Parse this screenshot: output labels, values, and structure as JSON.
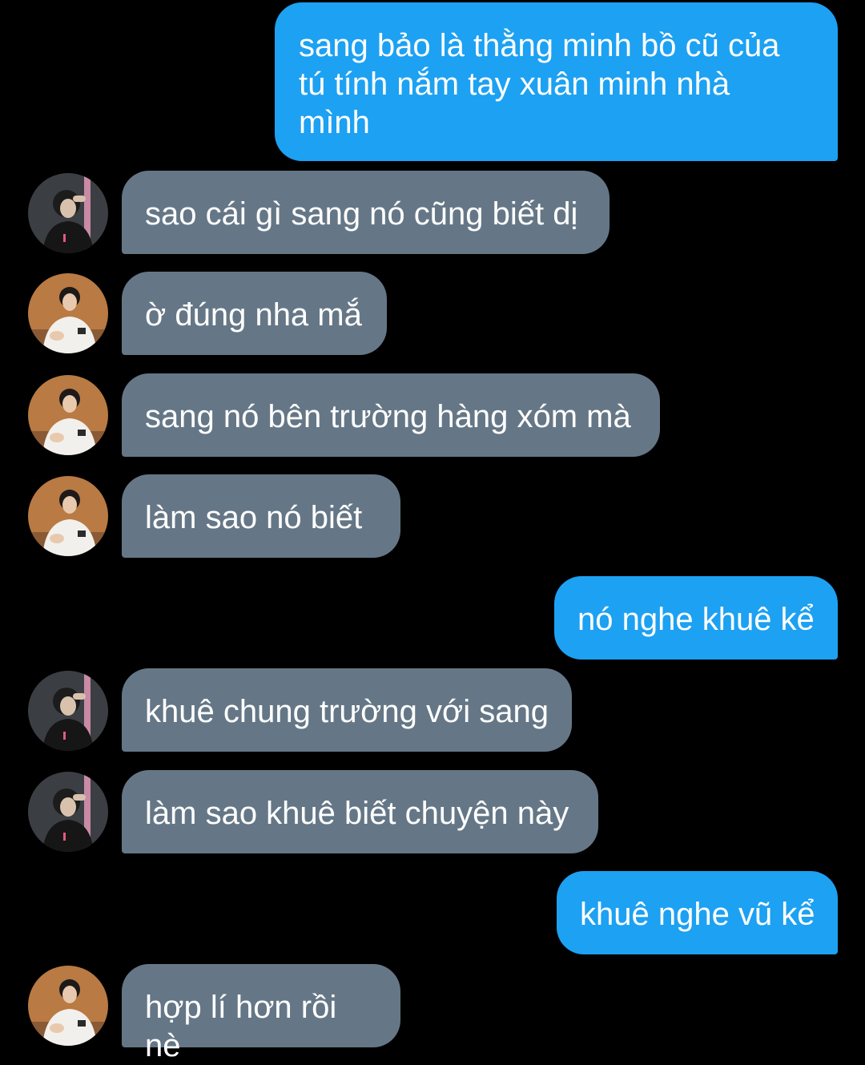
{
  "colors": {
    "background": "#000000",
    "outgoing_bubble": "#1da1f2",
    "incoming_bubble": "#657786",
    "text": "#ffffff"
  },
  "avatars": {
    "dark_shirt": "avatar-dark-shirt-photo",
    "white_shirt": "avatar-white-shirt-photo"
  },
  "messages": [
    {
      "direction": "outgoing",
      "text": "sang bảo là thằng minh bồ cũ của\ntú tính nắm tay xuân minh nhà\nmình"
    },
    {
      "direction": "incoming",
      "avatar": "dark_shirt",
      "text": "sao cái gì sang nó cũng biết dị"
    },
    {
      "direction": "incoming",
      "avatar": "white_shirt",
      "text": "ờ đúng nha mắ"
    },
    {
      "direction": "incoming",
      "avatar": "white_shirt",
      "text": "sang nó bên trường hàng xóm mà"
    },
    {
      "direction": "incoming",
      "avatar": "white_shirt",
      "text": "làm sao nó biết"
    },
    {
      "direction": "outgoing",
      "text": "nó nghe khuê kể"
    },
    {
      "direction": "incoming",
      "avatar": "dark_shirt",
      "text": "khuê chung trường với sang"
    },
    {
      "direction": "incoming",
      "avatar": "dark_shirt",
      "text": "làm sao khuê biết chuyện này"
    },
    {
      "direction": "outgoing",
      "text": "khuê nghe vũ kể"
    },
    {
      "direction": "incoming",
      "avatar": "white_shirt",
      "text": "hợp lí hơn rồi nè"
    }
  ]
}
